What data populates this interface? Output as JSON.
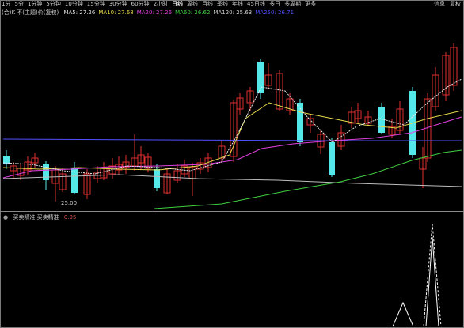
{
  "toolbar": {
    "items": [
      "1分",
      "5分",
      "1分钟",
      "5分钟",
      "10分钟",
      "15分钟",
      "30分钟",
      "60分钟",
      "2小时",
      "日线",
      "周线",
      "月线",
      "季线",
      "年线",
      "45日线",
      "多日",
      "多周期",
      "更多"
    ],
    "active_index": 9,
    "right_items": [
      "信息",
      "复权"
    ]
  },
  "main_legend": {
    "title": "(合)K 不(主题)价(复权)",
    "items": [
      {
        "label": "MA5",
        "value": "27.26",
        "color": "#e8e8e8"
      },
      {
        "label": "MA10",
        "value": "27.68",
        "color": "#e8d84a"
      },
      {
        "label": "MA20",
        "value": "27.26",
        "color": "#e040e0"
      },
      {
        "label": "MA60",
        "value": "26.62",
        "color": "#40d040"
      },
      {
        "label": "MA120",
        "value": "25.63",
        "color": "#cfcfcf"
      },
      {
        "label": "MA250",
        "value": "26.71",
        "color": "#5050ff"
      }
    ]
  },
  "low_price_label": "25.00",
  "indicator_legend": {
    "title": "买卖精准 买卖精准",
    "value": "0.95",
    "color": "#e05050"
  },
  "colors": {
    "up": "#e03030",
    "down": "#54e8e8",
    "ma5": "#e8e8e8",
    "ma10": "#e8d84a",
    "ma20": "#e040e0",
    "ma60": "#40d040",
    "ma120": "#bdbdbd",
    "ma250": "#5050ff"
  }
}
